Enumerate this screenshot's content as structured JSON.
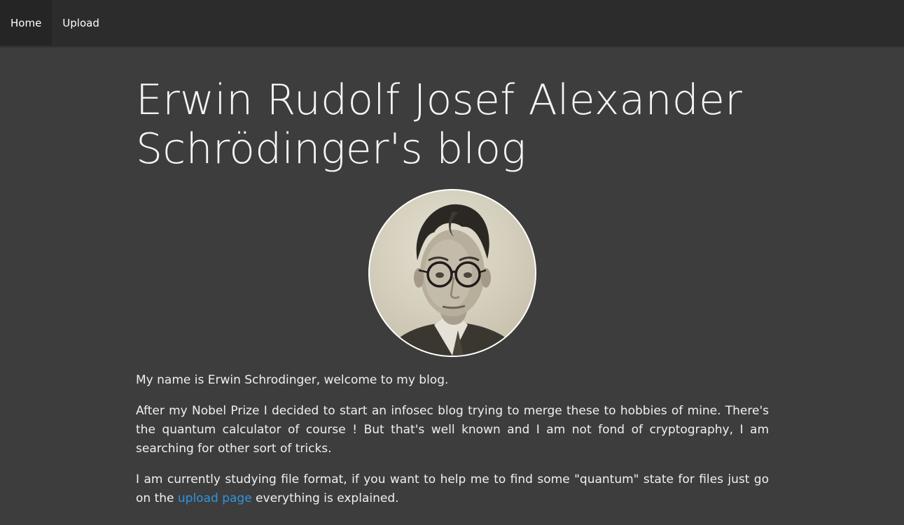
{
  "nav": {
    "home_label": "Home",
    "upload_label": "Upload"
  },
  "page": {
    "title": "Erwin Rudolf Josef Alexander Schrödinger's blog"
  },
  "intro": {
    "p1": "My name is Erwin Schrodinger, welcome to my blog.",
    "p2": "After my Nobel Prize I decided to start an infosec blog trying to merge these to hobbies of mine. There's the quantum calculator of course ! But that's well known and I am not fond of cryptography, I am searching for other sort of tricks.",
    "p3_before": "I am currently studying file format, if you want to help me to find some \"quantum\" state for files just go on the ",
    "p3_link": "upload page",
    "p3_after": " everything is explained."
  },
  "colors": {
    "background": "#3d3d3d",
    "navbar": "#2c2c2c",
    "link": "#2f95e0"
  }
}
